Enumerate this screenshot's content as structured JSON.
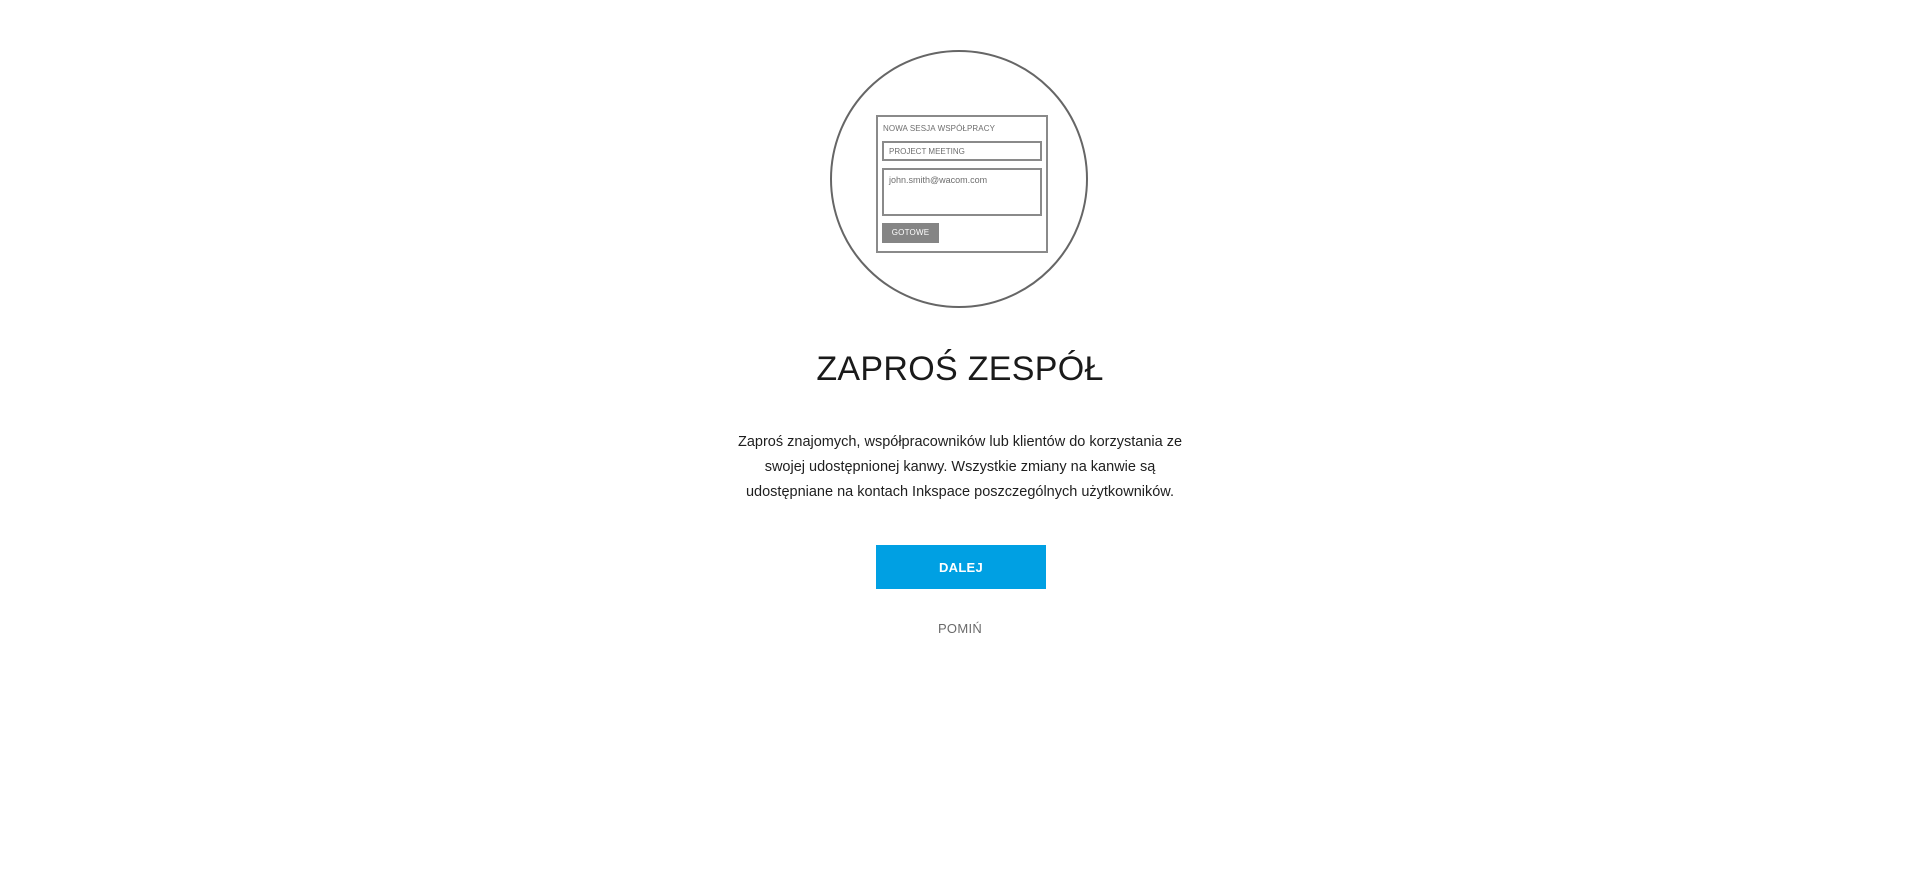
{
  "illustration": {
    "form_title": "NOWA SESJA WSPÓŁPRACY",
    "input_value": "PROJECT MEETING",
    "textarea_value": "john.smith@wacom.com",
    "button_label": "GOTOWE"
  },
  "heading": "ZAPROŚ ZESPÓŁ",
  "description": "Zaproś znajomych, współpracowników lub klientów do korzystania ze swojej udostępnionej kanwy. Wszystkie zmiany na kanwie są udostępniane na kontach Inkspace poszczególnych użytkowników.",
  "next_button_label": "DALEJ",
  "skip_label": "POMIŃ",
  "colors": {
    "accent": "#00a0e3",
    "illustration_stroke": "#666666"
  }
}
